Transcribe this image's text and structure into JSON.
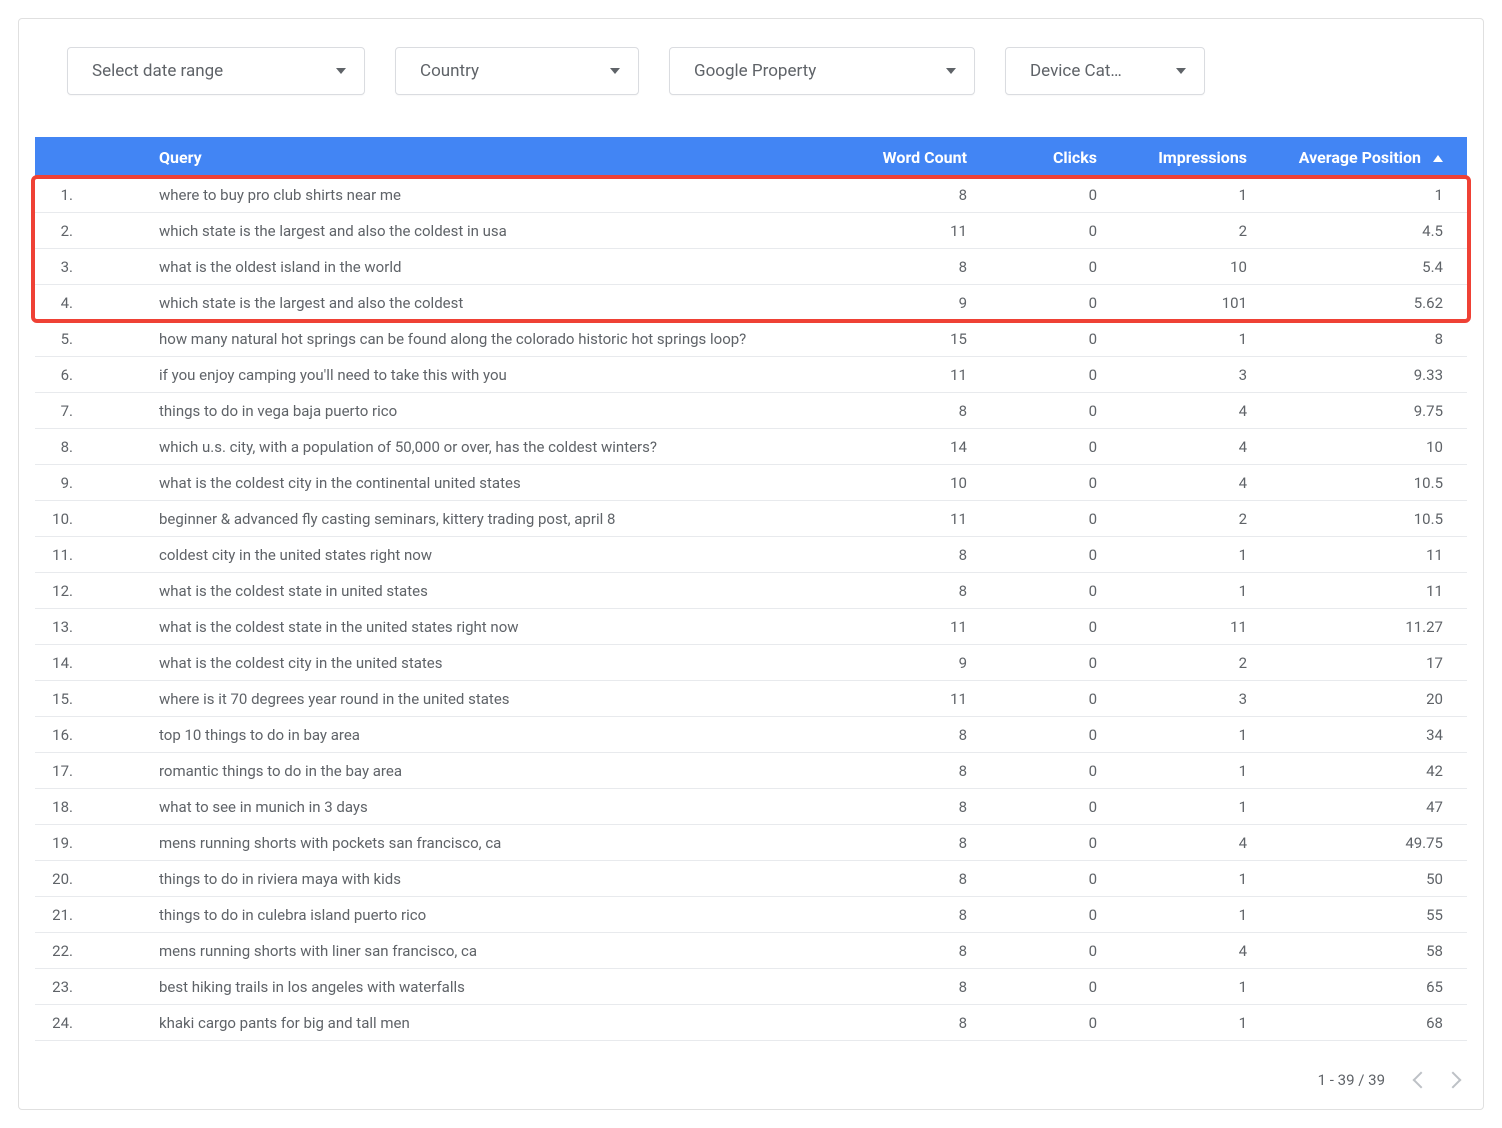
{
  "filters": {
    "date_range": "Select date range",
    "country": "Country",
    "property": "Google Property",
    "device": "Device Cat…"
  },
  "columns": {
    "query": "Query",
    "word_count": "Word Count",
    "clicks": "Clicks",
    "impressions": "Impressions",
    "avg_position": "Average Position"
  },
  "sort": {
    "column": "avg_position",
    "direction": "asc"
  },
  "rows": [
    {
      "n": "1.",
      "q": "where to buy pro club shirts near me",
      "wc": "8",
      "cl": "0",
      "im": "1",
      "ap": "1"
    },
    {
      "n": "2.",
      "q": "which state is the largest and also the coldest in usa",
      "wc": "11",
      "cl": "0",
      "im": "2",
      "ap": "4.5"
    },
    {
      "n": "3.",
      "q": "what is the oldest island in the world",
      "wc": "8",
      "cl": "0",
      "im": "10",
      "ap": "5.4"
    },
    {
      "n": "4.",
      "q": "which state is the largest and also the coldest",
      "wc": "9",
      "cl": "0",
      "im": "101",
      "ap": "5.62"
    },
    {
      "n": "5.",
      "q": "how many natural hot springs can be found along the colorado historic hot springs loop?",
      "wc": "15",
      "cl": "0",
      "im": "1",
      "ap": "8"
    },
    {
      "n": "6.",
      "q": "if you enjoy camping you'll need to take this with you",
      "wc": "11",
      "cl": "0",
      "im": "3",
      "ap": "9.33"
    },
    {
      "n": "7.",
      "q": "things to do in vega baja puerto rico",
      "wc": "8",
      "cl": "0",
      "im": "4",
      "ap": "9.75"
    },
    {
      "n": "8.",
      "q": "which u.s. city, with a population of 50,000 or over, has the coldest winters?",
      "wc": "14",
      "cl": "0",
      "im": "4",
      "ap": "10"
    },
    {
      "n": "9.",
      "q": "what is the coldest city in the continental united states",
      "wc": "10",
      "cl": "0",
      "im": "4",
      "ap": "10.5"
    },
    {
      "n": "10.",
      "q": "beginner & advanced fly casting seminars, kittery trading post, april 8",
      "wc": "11",
      "cl": "0",
      "im": "2",
      "ap": "10.5"
    },
    {
      "n": "11.",
      "q": "coldest city in the united states right now",
      "wc": "8",
      "cl": "0",
      "im": "1",
      "ap": "11"
    },
    {
      "n": "12.",
      "q": "what is the coldest state in united states",
      "wc": "8",
      "cl": "0",
      "im": "1",
      "ap": "11"
    },
    {
      "n": "13.",
      "q": "what is the coldest state in the united states right now",
      "wc": "11",
      "cl": "0",
      "im": "11",
      "ap": "11.27"
    },
    {
      "n": "14.",
      "q": "what is the coldest city in the united states",
      "wc": "9",
      "cl": "0",
      "im": "2",
      "ap": "17"
    },
    {
      "n": "15.",
      "q": "where is it 70 degrees year round in the united states",
      "wc": "11",
      "cl": "0",
      "im": "3",
      "ap": "20"
    },
    {
      "n": "16.",
      "q": "top 10 things to do in bay area",
      "wc": "8",
      "cl": "0",
      "im": "1",
      "ap": "34"
    },
    {
      "n": "17.",
      "q": "romantic things to do in the bay area",
      "wc": "8",
      "cl": "0",
      "im": "1",
      "ap": "42"
    },
    {
      "n": "18.",
      "q": "what to see in munich in 3 days",
      "wc": "8",
      "cl": "0",
      "im": "1",
      "ap": "47"
    },
    {
      "n": "19.",
      "q": "mens running shorts with pockets san francisco, ca",
      "wc": "8",
      "cl": "0",
      "im": "4",
      "ap": "49.75"
    },
    {
      "n": "20.",
      "q": "things to do in riviera maya with kids",
      "wc": "8",
      "cl": "0",
      "im": "1",
      "ap": "50"
    },
    {
      "n": "21.",
      "q": "things to do in culebra island puerto rico",
      "wc": "8",
      "cl": "0",
      "im": "1",
      "ap": "55"
    },
    {
      "n": "22.",
      "q": "mens running shorts with liner san francisco, ca",
      "wc": "8",
      "cl": "0",
      "im": "4",
      "ap": "58"
    },
    {
      "n": "23.",
      "q": "best hiking trails in los angeles with waterfalls",
      "wc": "8",
      "cl": "0",
      "im": "1",
      "ap": "65"
    },
    {
      "n": "24.",
      "q": "khaki cargo pants for big and tall men",
      "wc": "8",
      "cl": "0",
      "im": "1",
      "ap": "68"
    }
  ],
  "pager": {
    "range_text": "1 - 39 / 39"
  },
  "highlight": {
    "first_row_index": 0,
    "last_row_index": 3
  }
}
